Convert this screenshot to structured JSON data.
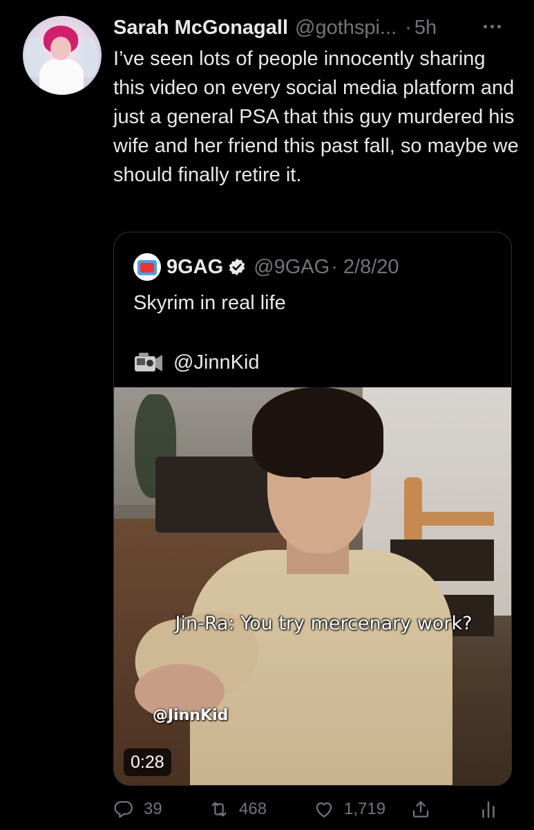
{
  "tweet": {
    "display_name": "Sarah McGonagall",
    "handle": "@gothspi...",
    "separator": "·",
    "time": "5h",
    "text": "I’ve seen lots of people innocently sharing this video on every social media platform and just a general PSA that this guy murdered his wife and her friend this past fall, so maybe we should finally retire it."
  },
  "quote": {
    "display_name": "9GAG",
    "handle": "@9GAG",
    "date": "· 2/8/20",
    "text": "Skyrim in real life",
    "credit": "@JinnKid",
    "video": {
      "caption": "Jin-Ra: You try mercenary work?",
      "watermark": "@JinnKid",
      "duration": "0:28"
    }
  },
  "actions": {
    "reply_count": "39",
    "retweet_count": "468",
    "like_count": "1,719"
  },
  "colors": {
    "background": "#000000",
    "text": "#e7e9ea",
    "secondary": "#71767b",
    "border": "#2f3336"
  }
}
